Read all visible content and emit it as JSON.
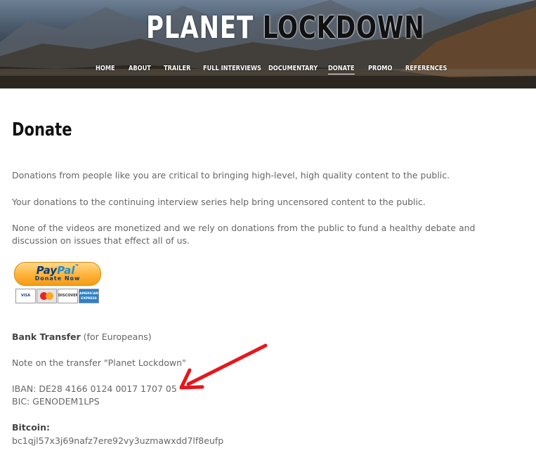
{
  "site": {
    "title_word1": "PLANET",
    "title_word2": "LOCKDOWN"
  },
  "nav": {
    "items": [
      "HOME",
      "ABOUT",
      "TRAILER",
      "FULL INTERVIEWS",
      "DOCUMENTARY",
      "DONATE",
      "PROMO",
      "REFERENCES"
    ],
    "active": "DONATE"
  },
  "page": {
    "title": "Donate",
    "para1": "Donations from people like you are critical to bringing high-level, high quality content to the public.",
    "para2": "Your donations to the continuing interview series help bring uncensored content to the public.",
    "para3": "None of the videos are monetized and we rely on donations from the public to fund a healthy debate and discussion on issues that effect all of us."
  },
  "paypal": {
    "logo_pay": "Pay",
    "logo_pal": "Pal",
    "tm": "™",
    "sub": "Donate Now",
    "cards": [
      "VISA",
      "MasterCard",
      "DISCOVER",
      "AMERICAN EXPRESS"
    ]
  },
  "bank": {
    "label": "Bank Transfer",
    "note_suffix": " (for Europeans)",
    "note": "Note on the transfer \"Planet Lockdown\"",
    "iban": "IBAN: DE28 4166 0124 0017 1707 05",
    "bic": "BIC: GENODEM1LPS"
  },
  "bitcoin": {
    "label": "Bitcoin:",
    "address": "bc1qjl57x3j69nafz7ere92vy3uzmawxdd7lf8eufp"
  },
  "colors": {
    "arrow": "#e8161b",
    "heading": "#111111",
    "body_text": "#666666"
  }
}
